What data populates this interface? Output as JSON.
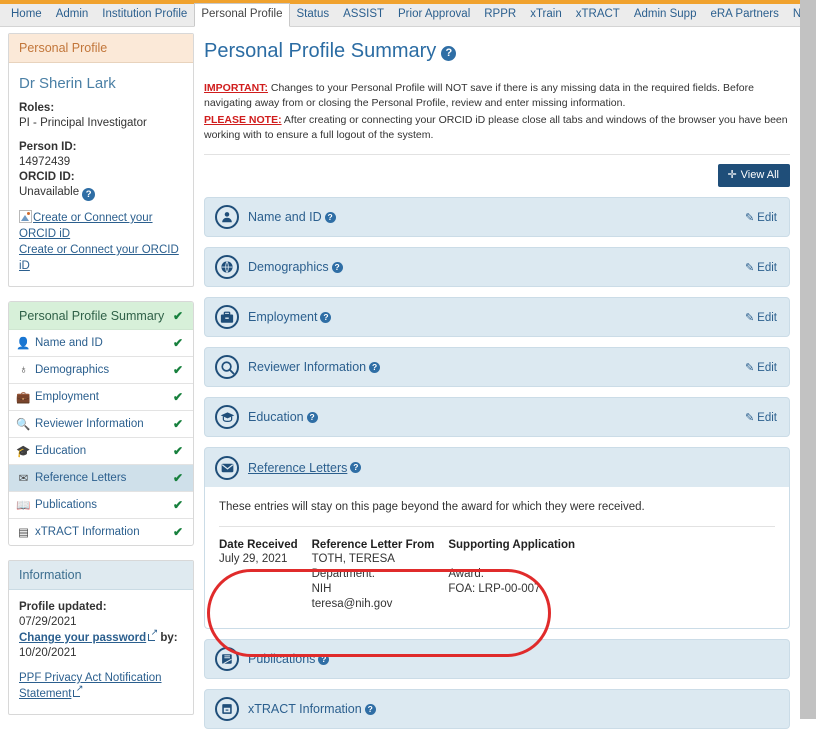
{
  "nav_tabs": [
    {
      "label": "Home",
      "active": false
    },
    {
      "label": "Admin",
      "active": false
    },
    {
      "label": "Institution Profile",
      "active": false
    },
    {
      "label": "Personal Profile",
      "active": true
    },
    {
      "label": "Status",
      "active": false
    },
    {
      "label": "ASSIST",
      "active": false
    },
    {
      "label": "Prior Approval",
      "active": false
    },
    {
      "label": "RPPR",
      "active": false
    },
    {
      "label": "xTrain",
      "active": false
    },
    {
      "label": "xTRACT",
      "active": false
    },
    {
      "label": "Admin Supp",
      "active": false
    },
    {
      "label": "eRA Partners",
      "active": false
    },
    {
      "label": "Non-Research",
      "active": false
    }
  ],
  "profile_panel": {
    "header": "Personal Profile",
    "name": "Dr Sherin Lark",
    "roles_label": "Roles:",
    "roles_value": "PI - Principal Investigator",
    "person_id_label": "Person ID:",
    "person_id_value": "14972439",
    "orcid_label": "ORCID ID:",
    "orcid_value": "Unavailable",
    "orcid_help": "?",
    "orcid_link_broken": "Create or Connect your ORCID iD",
    "orcid_link": "Create or Connect your ORCID iD"
  },
  "nav_panel": {
    "header": "Personal Profile Summary",
    "header_check": "✔",
    "items": [
      {
        "label": "Name and ID",
        "icon": "👤",
        "check": "✔",
        "selected": false
      },
      {
        "label": "Demographics",
        "icon": "♁",
        "check": "✔",
        "selected": false
      },
      {
        "label": "Employment",
        "icon": "💼",
        "check": "✔",
        "selected": false
      },
      {
        "label": "Reviewer Information",
        "icon": "🔍",
        "check": "✔",
        "selected": false
      },
      {
        "label": "Education",
        "icon": "🎓",
        "check": "✔",
        "selected": false
      },
      {
        "label": "Reference Letters",
        "icon": "✉",
        "check": "✔",
        "selected": true
      },
      {
        "label": "Publications",
        "icon": "📖",
        "check": "✔",
        "selected": false
      },
      {
        "label": "xTRACT Information",
        "icon": "▤",
        "check": "✔",
        "selected": false
      }
    ]
  },
  "information_panel": {
    "header": "Information",
    "profile_updated_label": "Profile updated:",
    "profile_updated_value": "07/29/2021",
    "change_password_label": "Change your password",
    "change_password_by": " by:",
    "change_password_date": "10/20/2021",
    "privacy_link": "PPF Privacy Act Notification Statement"
  },
  "main": {
    "title": "Personal Profile Summary",
    "title_help": "?",
    "notice_1_tag": "IMPORTANT:",
    "notice_1_text": " Changes to your Personal Profile will NOT save if there is any missing data in the required fields. Before navigating away from or closing the Personal Profile, review and enter missing information.",
    "notice_2_tag": "PLEASE NOTE:",
    "notice_2_text": " After creating or connecting your ORCID iD please close all tabs and windows of the browser you have been working with to ensure a full logout of the system.",
    "view_all_label": "View All",
    "view_all_plus": "➕",
    "sections": [
      {
        "label": "Name and ID",
        "icon": "👤",
        "help": "?",
        "edit": "Edit",
        "expanded": false
      },
      {
        "label": "Demographics",
        "icon": "♁",
        "help": "?",
        "edit": "Edit",
        "expanded": false
      },
      {
        "label": "Employment",
        "icon": "💼",
        "help": "?",
        "edit": "Edit",
        "expanded": false
      },
      {
        "label": "Reviewer Information",
        "icon": "🔍",
        "help": "?",
        "edit": "Edit",
        "expanded": false
      },
      {
        "label": "Education",
        "icon": "🎓",
        "help": "?",
        "edit": "Edit",
        "expanded": false
      }
    ],
    "reference_letters": {
      "label": "Reference Letters",
      "help": "?",
      "icon": "✉",
      "note": "These entries will stay on this page beyond the award for which they were received.",
      "columns": [
        "Date Received",
        "Reference Letter From",
        "Supporting Application"
      ],
      "rows": [
        {
          "date_received": "July 29, 2021",
          "from_name": "TOTH, TERESA",
          "from_dept_label": "Department:",
          "from_dept_value": "NIH",
          "from_email": "teresa@nih.gov",
          "award_label": "Award:",
          "award_foa": "FOA: LRP-00-007"
        }
      ]
    },
    "bottom_sections": [
      {
        "label": "Publications",
        "icon": "📖",
        "help": "?",
        "expanded": false
      },
      {
        "label": "xTRACT Information",
        "icon": "▤",
        "help": "?",
        "expanded": false
      }
    ]
  },
  "colors": {
    "top_bar": "#f0a22e",
    "accent_blue": "#1f4e79",
    "link_blue": "#2b5f8e",
    "section_bg": "#dce9f1",
    "nav_green": "#d7f0d9",
    "profile_orange": "#fbe9d8",
    "highlight_red": "#e02b2b",
    "check_green": "#17803d"
  }
}
